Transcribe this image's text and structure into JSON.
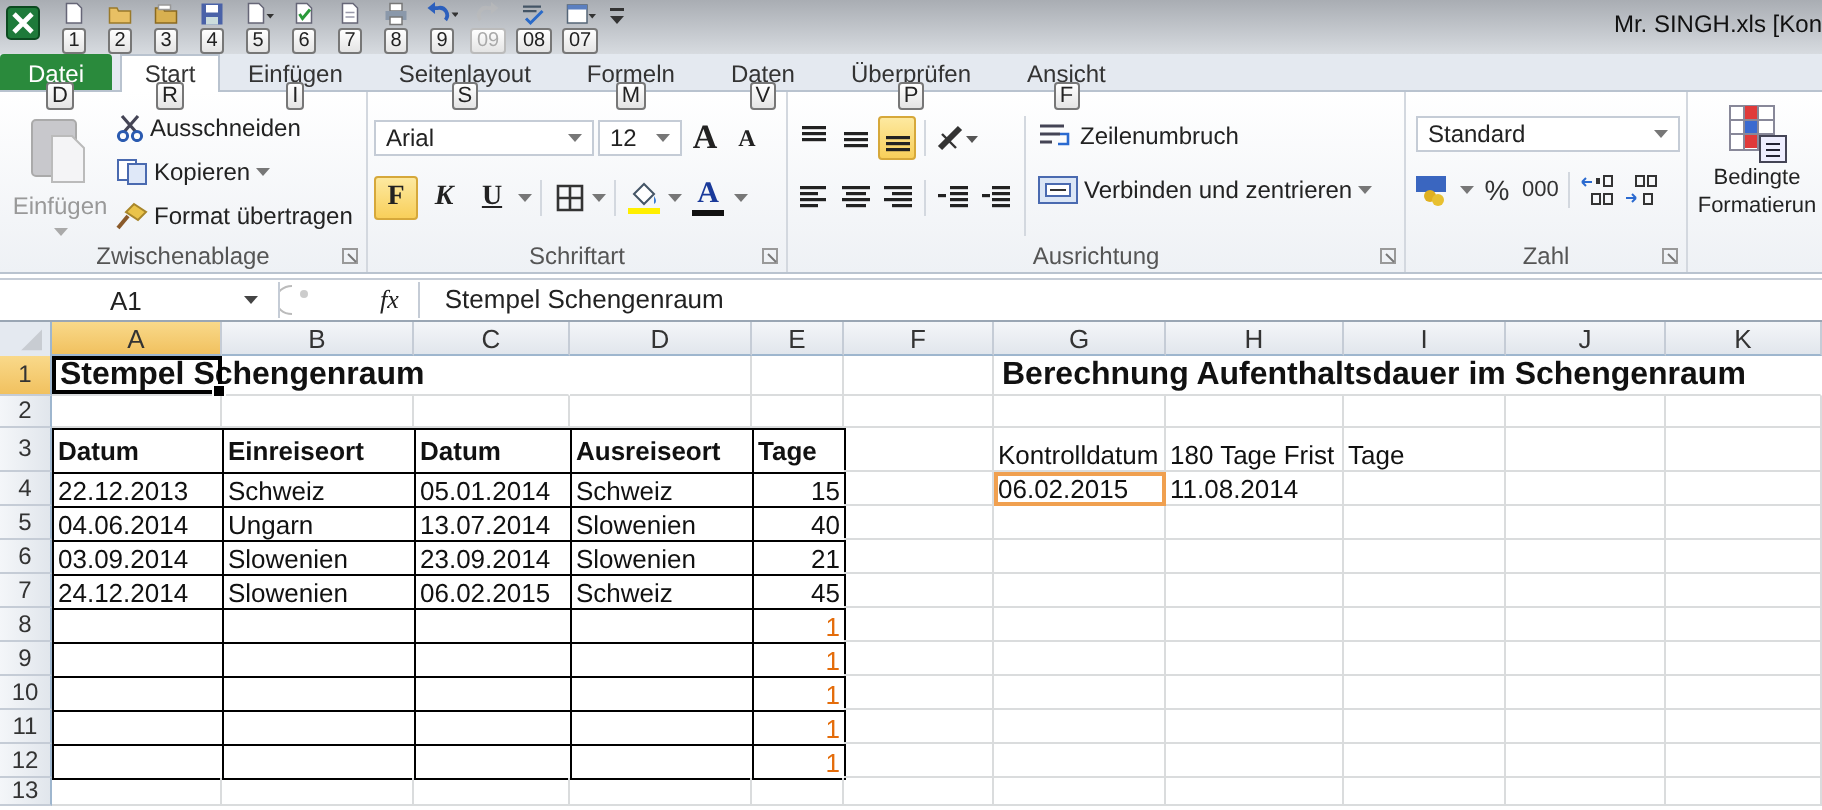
{
  "title_bar": {
    "quick_access": [
      {
        "keytip": "1",
        "disabled": false
      },
      {
        "keytip": "2",
        "disabled": false
      },
      {
        "keytip": "3",
        "disabled": false
      },
      {
        "keytip": "4",
        "disabled": false
      },
      {
        "keytip": "5",
        "disabled": false
      },
      {
        "keytip": "6",
        "disabled": false
      },
      {
        "keytip": "7",
        "disabled": false
      },
      {
        "keytip": "8",
        "disabled": false
      },
      {
        "keytip": "9",
        "disabled": false
      },
      {
        "keytip": "09",
        "disabled": true
      },
      {
        "keytip": "08",
        "disabled": false
      },
      {
        "keytip": "07",
        "disabled": false
      }
    ],
    "title": "Mr. SINGH.xls  [Kon"
  },
  "tabs": [
    {
      "label": "Datei",
      "keytip": "D",
      "kind": "file",
      "selected": false
    },
    {
      "label": "Start",
      "keytip": "R",
      "kind": "tab",
      "selected": true
    },
    {
      "label": "Einfügen",
      "keytip": "I",
      "kind": "tab",
      "selected": false
    },
    {
      "label": "Seitenlayout",
      "keytip": "S",
      "kind": "tab",
      "selected": false
    },
    {
      "label": "Formeln",
      "keytip": "M",
      "kind": "tab",
      "selected": false
    },
    {
      "label": "Daten",
      "keytip": "V",
      "kind": "tab",
      "selected": false
    },
    {
      "label": "Überprüfen",
      "keytip": "P",
      "kind": "tab",
      "selected": false
    },
    {
      "label": "Ansicht",
      "keytip": "F",
      "kind": "tab",
      "selected": false
    }
  ],
  "ribbon": {
    "clipboard": {
      "label": "Zwischenablage",
      "paste": {
        "label": "Einfügen",
        "disabled": true
      },
      "cut": "Ausschneiden",
      "copy": "Kopieren",
      "format_painter": "Format übertragen"
    },
    "font": {
      "label": "Schriftart",
      "family": "Arial",
      "size": "12",
      "grow": "A",
      "shrink": "A",
      "font_color": "A",
      "styles": [
        {
          "label": "F",
          "selected": true
        },
        {
          "label": "K",
          "selected": false
        },
        {
          "label": "U",
          "selected": false
        }
      ]
    },
    "alignment": {
      "label": "Ausrichtung",
      "vertical": [
        {
          "selected": false
        },
        {
          "selected": false
        },
        {
          "selected": true
        }
      ],
      "wrap": "Zeilenumbruch",
      "merge": "Verbinden und zentrieren"
    },
    "number": {
      "label": "Zahl",
      "format": "Standard",
      "percent": "%",
      "thousands": "000"
    },
    "styles": {
      "conditional": [
        "Bedingte",
        "Formatierun"
      ]
    }
  },
  "formula_bar": {
    "name_box": "A1",
    "function_label": "fx",
    "formula": "Stempel Schengenraum"
  },
  "sheet": {
    "columns": [
      {
        "label": "A",
        "selected": true
      },
      {
        "label": "B",
        "selected": false
      },
      {
        "label": "C",
        "selected": false
      },
      {
        "label": "D",
        "selected": false
      },
      {
        "label": "E",
        "selected": false
      },
      {
        "label": "F",
        "selected": false
      },
      {
        "label": "G",
        "selected": false
      },
      {
        "label": "H",
        "selected": false
      },
      {
        "label": "I",
        "selected": false
      },
      {
        "label": "J",
        "selected": false
      },
      {
        "label": "K",
        "selected": false
      }
    ],
    "rows": [
      {
        "label": "1",
        "selected": true
      },
      {
        "label": "2",
        "selected": false
      },
      {
        "label": "3",
        "selected": false
      },
      {
        "label": "4",
        "selected": false
      },
      {
        "label": "5",
        "selected": false
      },
      {
        "label": "6",
        "selected": false
      },
      {
        "label": "7",
        "selected": false
      },
      {
        "label": "8",
        "selected": false
      },
      {
        "label": "9",
        "selected": false
      },
      {
        "label": "10",
        "selected": false
      },
      {
        "label": "11",
        "selected": false
      },
      {
        "label": "12",
        "selected": false
      },
      {
        "label": "13",
        "selected": false
      }
    ],
    "title": "Stempel Schengenraum",
    "table": {
      "headers": [
        "Datum",
        "Einreiseort",
        "Datum",
        "Ausreiseort",
        "Tage"
      ],
      "rows": [
        {
          "entry": [
            "22.12.2013",
            "Schweiz",
            "05.01.2014",
            "Schweiz"
          ],
          "tage": "15",
          "flagged": false
        },
        {
          "entry": [
            "04.06.2014",
            "Ungarn",
            "13.07.2014",
            "Slowenien"
          ],
          "tage": "40",
          "flagged": false
        },
        {
          "entry": [
            "03.09.2014",
            "Slowenien",
            "23.09.2014",
            "Slowenien"
          ],
          "tage": "21",
          "flagged": false
        },
        {
          "entry": [
            "24.12.2014",
            "Slowenien",
            "06.02.2015",
            "Schweiz"
          ],
          "tage": "45",
          "flagged": false
        },
        {
          "tage": "1",
          "flagged": true
        },
        {
          "tage": "1",
          "flagged": true
        },
        {
          "tage": "1",
          "flagged": true
        },
        {
          "tage": "1",
          "flagged": true
        },
        {
          "tage": "1",
          "flagged": true
        }
      ]
    },
    "calc": {
      "title": "Berechnung Aufenthaltsdauer im Schengenraum",
      "labels": [
        "Kontrolldatum",
        "180 Tage Frist",
        "Tage"
      ],
      "values": [
        {
          "text": "06.02.2015",
          "selected": true
        },
        {
          "text": "11.08.2014",
          "selected": false
        }
      ]
    }
  }
}
